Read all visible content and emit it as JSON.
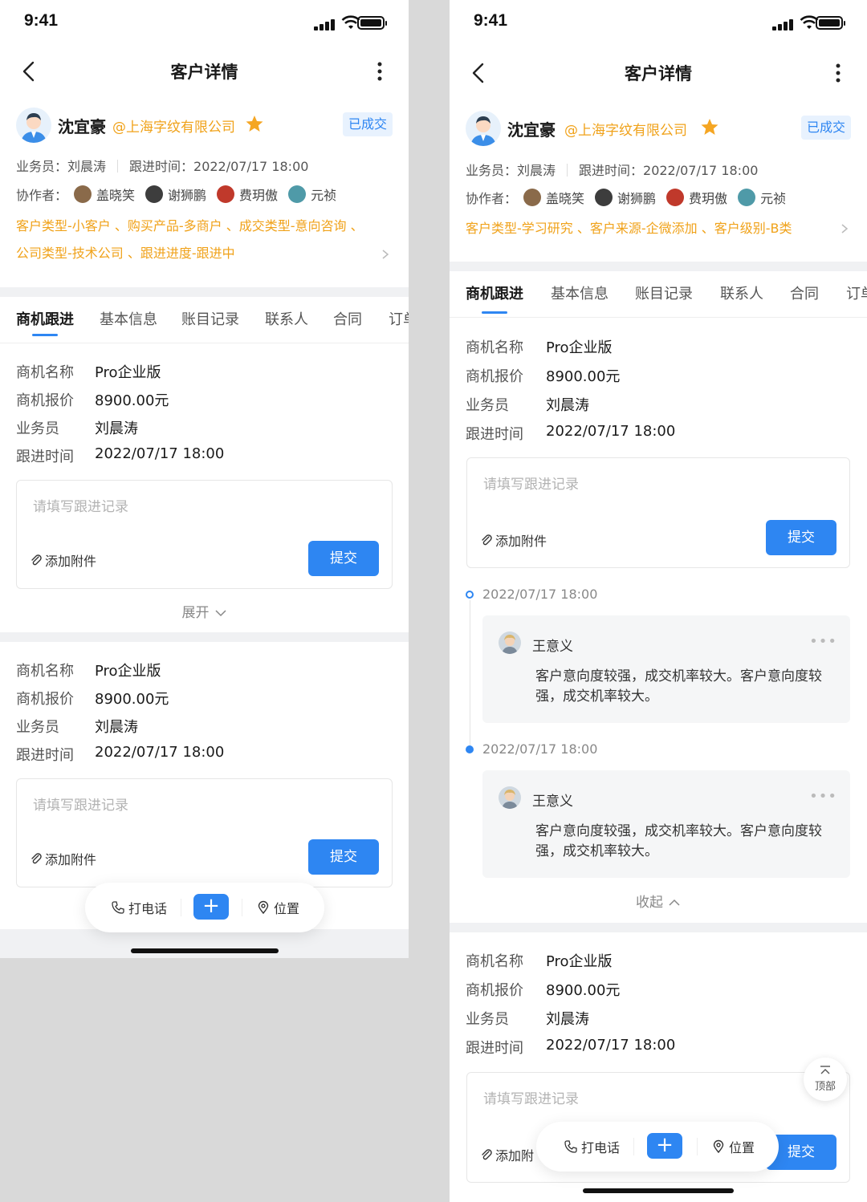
{
  "status": {
    "time": "9:41"
  },
  "nav": {
    "title": "客户详情"
  },
  "customer": {
    "name": "沈宜豪",
    "company": "@上海字纹有限公司",
    "status_badge": "已成交",
    "salesperson_text": "业务员：刘晨涛",
    "follow_time_text": "跟进时间：2022/07/17 18:00",
    "collaborators_label": "协作者：",
    "collaborators": [
      {
        "name": "盖晓笑",
        "color": "#8a6a4a"
      },
      {
        "name": "谢狮鹏",
        "color": "#3d3d3d"
      },
      {
        "name": "费玥傲",
        "color": "#c0392b"
      },
      {
        "name": "元祯",
        "color": "#4f9aa8"
      }
    ]
  },
  "left": {
    "tags_line1": "客户类型-小客户 、购买产品-多商户 、成交类型-意向咨询 、",
    "tags_line2": "公司类型-技术公司 、跟进进度-跟进中",
    "tabs": [
      "商机跟进",
      "基本信息",
      "账目记录",
      "联系人",
      "合同",
      "订单"
    ],
    "expand_label": "展开"
  },
  "right": {
    "tags_line1": "客户类型-学习研究 、客户来源-企微添加 、客户级别-B类",
    "tabs": [
      "商机跟进",
      "基本信息",
      "账目记录",
      "联系人",
      "合同",
      "订单"
    ],
    "collapse_label": "收起",
    "totop_label": "顶部",
    "timeline": [
      {
        "time": "2022/07/17 18:00",
        "user": "王意义",
        "text": "客户意向度较强，成交机率较大。客户意向度较强，成交机率较大。"
      },
      {
        "time": "2022/07/17 18:00",
        "user": "王意义",
        "text": "客户意向度较强，成交机率较大。客户意向度较强，成交机率较大。"
      }
    ]
  },
  "opportunity": {
    "labels": {
      "name": "商机名称",
      "quote": "商机报价",
      "salesperson": "业务员",
      "follow_time": "跟进时间"
    },
    "values": {
      "name": "Pro企业版",
      "quote": "8900.00元",
      "salesperson": "刘晨涛",
      "follow_time": "2022/07/17 18:00"
    }
  },
  "follow_input": {
    "placeholder": "请填写跟进记录",
    "attach_label": "添加附件",
    "attach_label_truncated": "添加附",
    "submit_label": "提交"
  },
  "floating_bar": {
    "call_label": "打电话",
    "plus_label": "+",
    "location_label": "位置"
  },
  "colors": {
    "accent": "#2e86f2",
    "tag": "#f0a21a",
    "star": "#f5a623"
  }
}
